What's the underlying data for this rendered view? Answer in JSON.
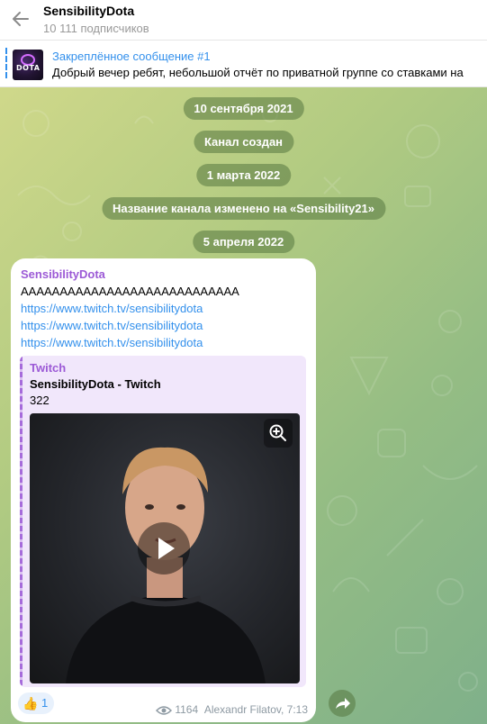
{
  "header": {
    "title": "SensibilityDota",
    "subtitle": "10 111 подписчиков"
  },
  "pinned": {
    "title": "Закреплённое сообщение #1",
    "text": "Добрый вечер ребят, небольшой отчёт по приватной группе со ставками на",
    "thumb_text": "DOTA"
  },
  "service_messages": [
    "10 сентября 2021",
    "Канал создан",
    "1 марта 2022",
    "Название канала изменено на «Sensibility21»",
    "5 апреля 2022"
  ],
  "message": {
    "sender": "SensibilityDota",
    "text": "АААААААААААААААААААААААААААА",
    "links": [
      "https://www.twitch.tv/sensibilitydota",
      "https://www.twitch.tv/sensibilitydota",
      "https://www.twitch.tv/sensibilitydota"
    ],
    "preview": {
      "site": "Twitch",
      "title": "SensibilityDota - Twitch",
      "description": "322"
    },
    "reaction": {
      "emoji": "👍",
      "count": "1"
    },
    "views": "1164",
    "author": "Alexandr Filatov, 7:13"
  },
  "colors": {
    "accent": "#3390ec",
    "sender": "#9c5ad6",
    "service_bg": "#577640"
  },
  "icons": [
    "back-arrow-icon",
    "zoom-icon",
    "play-icon",
    "eye-icon",
    "share-icon"
  ]
}
